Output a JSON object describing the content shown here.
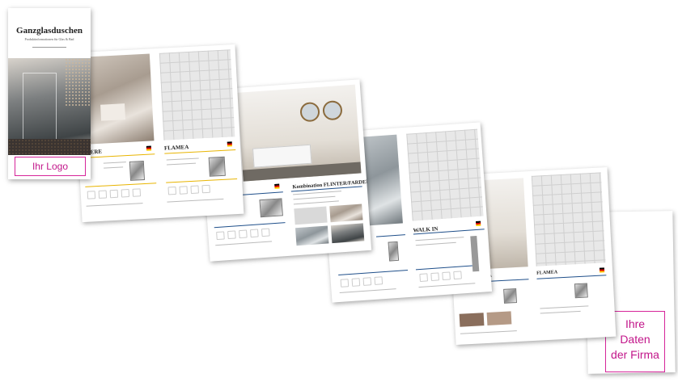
{
  "cover": {
    "title": "Ganzglasduschen",
    "subtitle": "Produktinformationen für Glas & Bad",
    "logo_placeholder": "Ihr Logo"
  },
  "spreads": [
    {
      "headings": [
        "STERE",
        "FLAMEA"
      ]
    },
    {
      "headings": [
        "Kombination FLINTER/FARDELLO"
      ]
    },
    {
      "headings": [
        "WALK IN"
      ]
    },
    {
      "headings": [
        "NA",
        "FLAMEA"
      ]
    }
  ],
  "company_placeholder": {
    "line1": "Ihre",
    "line2": "Daten",
    "line3": "der Firma"
  },
  "colors": {
    "accent_magenta": "#d6259a",
    "accent_yellow": "#e8b400",
    "accent_blue": "#1f4f8a"
  }
}
